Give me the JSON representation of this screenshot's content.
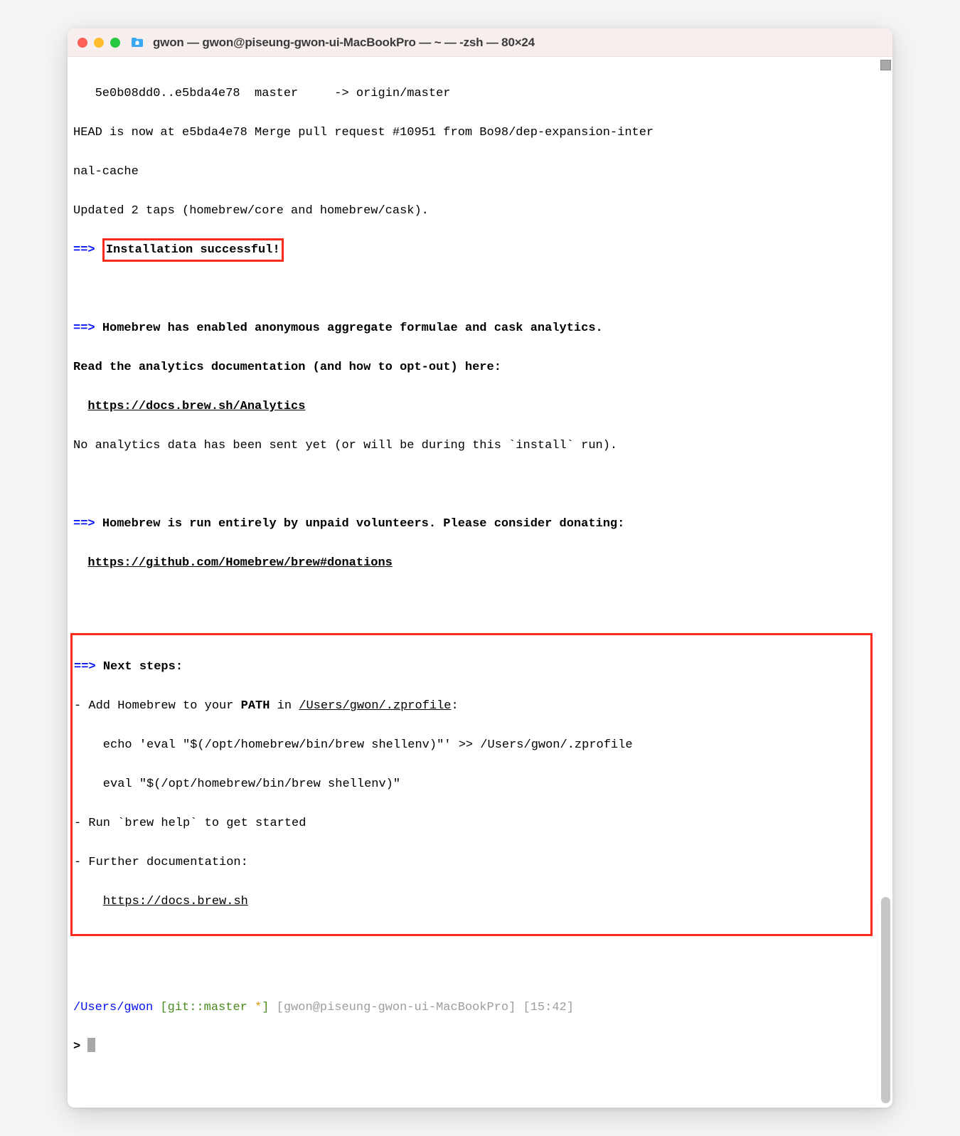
{
  "window": {
    "title": "gwon — gwon@piseung-gwon-ui-MacBookPro — ~ — -zsh — 80×24"
  },
  "lines": {
    "l1": "   5e0b08dd0..e5bda4e78  master     -> origin/master",
    "l2": "HEAD is now at e5bda4e78 Merge pull request #10951 from Bo98/dep-expansion-inter",
    "l3": "nal-cache",
    "l4": "Updated 2 taps (homebrew/core and homebrew/cask).",
    "arrow": "==>",
    "install_success": "Installation successful!",
    "analytics_head": "Homebrew has enabled anonymous aggregate formulae and cask analytics.",
    "analytics_read": "Read the analytics documentation (and how to opt-out) here:",
    "analytics_url": "https://docs.brew.sh/Analytics",
    "analytics_note": "No analytics data has been sent yet (or will be during this `install` run).",
    "donate_head": "Homebrew is run entirely by unpaid volunteers. Please consider donating:",
    "donate_url": "https://github.com/Homebrew/brew#donations",
    "next_steps": "Next steps:",
    "ns_add_pre": "- Add Homebrew to your ",
    "ns_add_path": "PATH",
    "ns_add_in": " in ",
    "ns_profile": "/Users/gwon/.zprofile",
    "ns_colon": ":",
    "ns_echo": "    echo 'eval \"$(/opt/homebrew/bin/brew shellenv)\"' >> /Users/gwon/.zprofile",
    "ns_eval": "    eval \"$(/opt/homebrew/bin/brew shellenv)\"",
    "ns_run": "- Run `brew help` to get started",
    "ns_further": "- Further documentation: ",
    "ns_docs_url": "https://docs.brew.sh",
    "prompt_path": "/Users/gwon",
    "prompt_git_open": " [",
    "prompt_git": "git::master ",
    "prompt_star": "*",
    "prompt_git_close": "]",
    "prompt_host": " [gwon@piseung-gwon-ui-MacBookPro] [15:42]",
    "prompt_caret": "> "
  }
}
